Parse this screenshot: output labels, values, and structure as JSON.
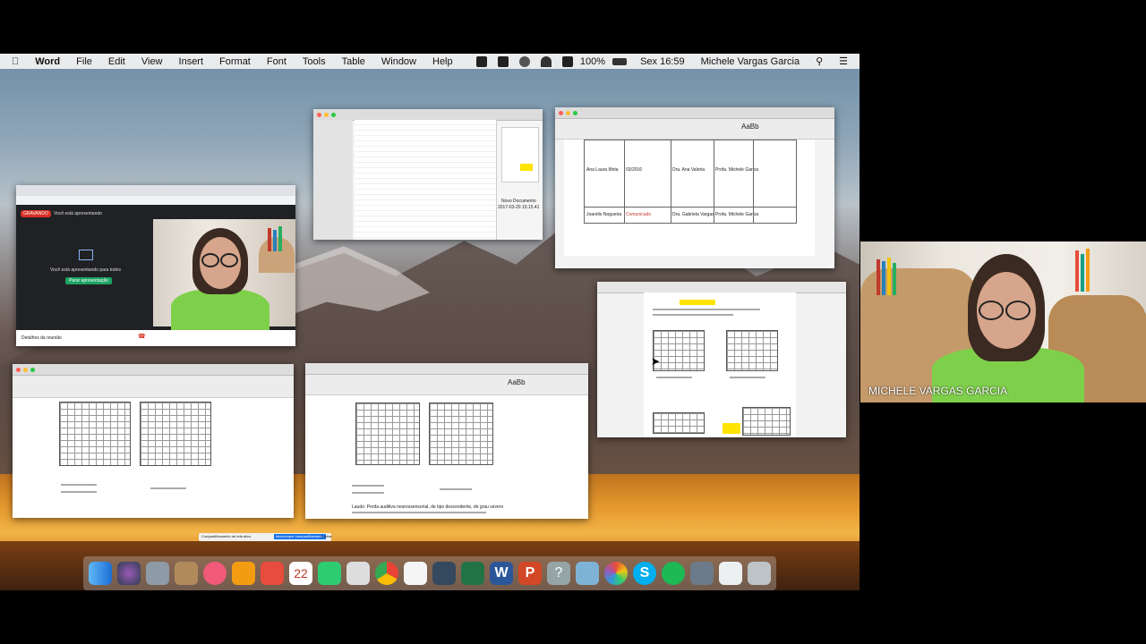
{
  "menubar": {
    "app": "Word",
    "items": [
      "File",
      "Edit",
      "View",
      "Insert",
      "Format",
      "Font",
      "Tools",
      "Table",
      "Window",
      "Help"
    ],
    "battery": "100%",
    "clock": "Sex 16:59",
    "user": "Michele Vargas Garcia"
  },
  "meet_window": {
    "recording_label": "GRAVANDO",
    "presenting_header": "Você está apresentando",
    "presenting_text": "Você está apresentando para todos",
    "stop_button": "Parar apresentação",
    "share_notice": "Compartilhamento de tela ativo",
    "share_stop": "Interromper compartilhamento",
    "share_hide": "Ocultar"
  },
  "finder_window": {
    "folder": "Novo Documento",
    "info": "2017-03-20 10.15.41"
  },
  "doc_top": {
    "style_label": "AaBb",
    "rows": [
      {
        "name": "Ana Laura Mota",
        "date": "03/2016",
        "who": "Dra. Ana Valeria",
        "teacher": "Profa. Michele Garcia"
      },
      {
        "name": "Joarelio Nogueira",
        "date": "Comunicado",
        "who": "Dra. Gabriela Vargas",
        "teacher": "Profa. Michele Garcia"
      }
    ]
  },
  "doc_bottom_middle": {
    "caption": "Laudo: Perda auditiva neurossensorial, de tipo descendente, de grau severo"
  },
  "participant": {
    "name": "MICHELE VARGAS GARCIA"
  },
  "colors": {
    "meet_green": "#1ea362",
    "shirt": "#7ed04a",
    "highlight": "#ffe400"
  }
}
